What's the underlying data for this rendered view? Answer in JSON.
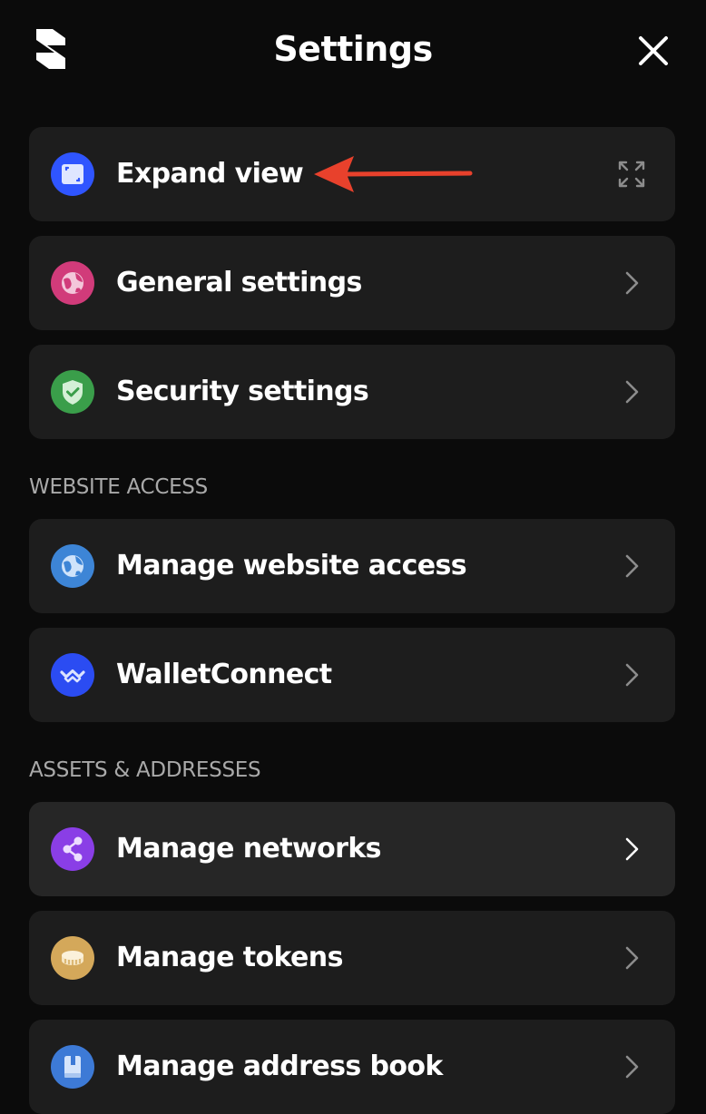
{
  "header": {
    "title": "Settings"
  },
  "annotation_arrow_color": "#e8412c",
  "rows": [
    {
      "label": "Expand view",
      "icon": "expand-view-icon",
      "icon_color": "#2f55ff",
      "trailing": "expand-arrows-icon"
    },
    {
      "label": "General settings",
      "icon": "globe-icon",
      "icon_color": "#d13b7a",
      "trailing": "chevron-right-icon"
    },
    {
      "label": "Security settings",
      "icon": "shield-check-icon",
      "icon_color": "#3a9e4a",
      "trailing": "chevron-right-icon"
    }
  ],
  "sections": [
    {
      "title": "WEBSITE ACCESS",
      "rows": [
        {
          "label": "Manage website access",
          "icon": "globe-icon",
          "icon_color": "#3d85d6",
          "trailing": "chevron-right-icon"
        },
        {
          "label": "WalletConnect",
          "icon": "walletconnect-icon",
          "icon_color": "#2b4cf2",
          "trailing": "chevron-right-icon"
        }
      ]
    },
    {
      "title": "ASSETS & ADDRESSES",
      "rows": [
        {
          "label": "Manage networks",
          "icon": "share-nodes-icon",
          "icon_color": "#8a3ee6",
          "trailing": "chevron-right-icon"
        },
        {
          "label": "Manage tokens",
          "icon": "coin-icon",
          "icon_color": "#d4a85a",
          "trailing": "chevron-right-icon"
        },
        {
          "label": "Manage address book",
          "icon": "address-book-icon",
          "icon_color": "#3d7ad6",
          "trailing": "chevron-right-icon"
        }
      ]
    }
  ]
}
